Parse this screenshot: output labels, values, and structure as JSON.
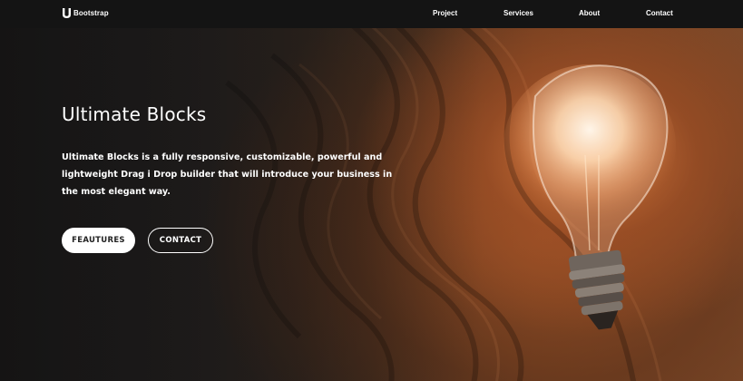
{
  "navbar": {
    "brand": {
      "icon": "bootstrap-logo-icon",
      "name": "Bootstrap"
    },
    "links": [
      {
        "label": "Project"
      },
      {
        "label": "Services"
      },
      {
        "label": "About"
      },
      {
        "label": "Contact"
      }
    ]
  },
  "hero": {
    "title": "Ultimate Blocks",
    "description": "Ultimate Blocks is a fully responsive, customizable, powerful and lightweight Drag i Drop builder that will introduce your business in the most elegant way.",
    "buttons": {
      "primary": "FEAUTURES",
      "secondary": "CONTACT"
    },
    "background": "light-bulb-on-wood-image"
  },
  "colors": {
    "navbar_bg": "#141414",
    "text": "#ffffff",
    "button_bg": "#ffffff"
  }
}
